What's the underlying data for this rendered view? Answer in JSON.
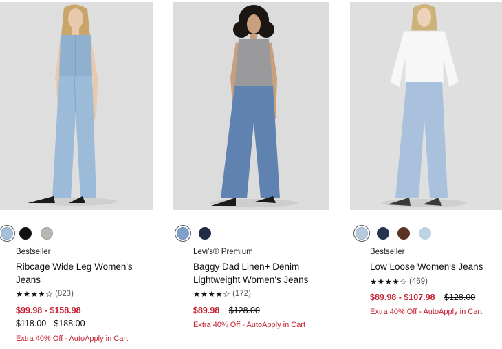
{
  "products": [
    {
      "tag": "Bestseller",
      "title": "Ribcage Wide Leg Women's\nJeans",
      "stars": "★★★★",
      "half_star": "☆",
      "review_count": "(823)",
      "sale_price": "$99.98 - $158.98",
      "original_price": "$118.00 - $188.00",
      "promo": "Extra 40% Off - AutoApply in Cart",
      "swatches": [
        {
          "name": "light-denim",
          "color": "#a9c0db",
          "selected": true
        },
        {
          "name": "black",
          "color": "#111111",
          "selected": false
        },
        {
          "name": "grey",
          "color": "#b8b8b3",
          "selected": false
        }
      ]
    },
    {
      "tag": "Levi's® Premium",
      "title": "Baggy Dad Linen+ Denim\nLightweight Women's Jeans",
      "stars": "★★★★",
      "half_star": "☆",
      "review_count": "(172)",
      "sale_price": "$89.98",
      "original_price": "$128.00",
      "promo": "Extra 40% Off - AutoApply in Cart",
      "swatches": [
        {
          "name": "medium-denim",
          "color": "#7f9fcc",
          "selected": true
        },
        {
          "name": "dark-navy",
          "color": "#1f2c44",
          "selected": false
        }
      ]
    },
    {
      "tag": "Bestseller",
      "title": "Low Loose Women's Jeans",
      "stars": "★★★★",
      "half_star": "☆",
      "review_count": "(469)",
      "sale_price": "$89.98 - $107.98",
      "original_price": "$128.00",
      "promo": "Extra 40% Off - AutoApply in Cart",
      "swatches": [
        {
          "name": "light-wash",
          "color": "#b6c9de",
          "selected": true
        },
        {
          "name": "navy",
          "color": "#23344f",
          "selected": false
        },
        {
          "name": "brown",
          "color": "#5a3324",
          "selected": false
        },
        {
          "name": "pale-blue",
          "color": "#bcd4e2",
          "selected": false
        }
      ]
    }
  ],
  "colors": {
    "sale": "#c41f30",
    "text": "#111111",
    "photo_bg": "#dcdcdc"
  }
}
